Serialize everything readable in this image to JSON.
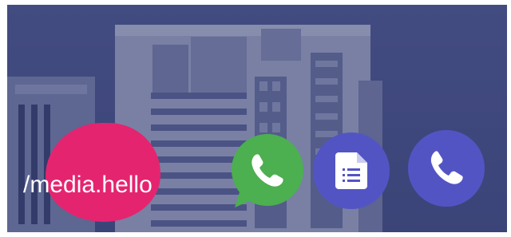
{
  "banner": {
    "handle": "/media.hello",
    "accent_color": "#e5246f",
    "overlay_color": "#3f4a7c"
  },
  "actions": [
    {
      "name": "whatsapp-button",
      "icon": "whatsapp-icon",
      "color": "#4caf50"
    },
    {
      "name": "document-button",
      "icon": "document-icon",
      "color": "#5354c4"
    },
    {
      "name": "phone-button",
      "icon": "phone-icon",
      "color": "#5354c4"
    }
  ]
}
